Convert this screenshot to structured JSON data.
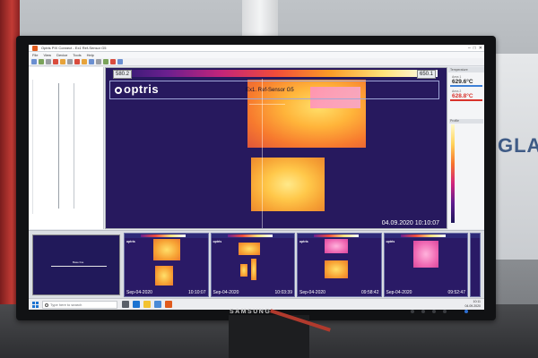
{
  "window": {
    "title": "Optris PIX Connect - Ex1 Ref-Sensor G5",
    "controls": [
      "–",
      "□",
      "✕"
    ]
  },
  "menu": [
    "File",
    "View",
    "Device",
    "Tools",
    "Help"
  ],
  "thermal_view": {
    "scale_min": "580.2",
    "scale_max": "650.1",
    "logo_text": "optris",
    "measure_label": "Ex1. Ref-Sensor G5",
    "timestamp": "04.09.2020  10:10:07"
  },
  "right_panel": {
    "header": "Temperature",
    "temp1": {
      "label": "Area 1",
      "value": "629.6°C",
      "color": "#3d7fd6"
    },
    "temp2": {
      "label": "Area 2",
      "value": "628.8°C",
      "color": "#d8322b"
    },
    "sub_header": "Profile"
  },
  "mini_view": {
    "label": "Base line"
  },
  "thumbnails": [
    {
      "logo": "optris",
      "date": "Sep-04-2020",
      "time": "10:10:07"
    },
    {
      "logo": "optris",
      "date": "Sep-04-2020",
      "time": "10:03:39"
    },
    {
      "logo": "optris",
      "date": "Sep-04-2020",
      "time": "09:58:42"
    },
    {
      "logo": "optris",
      "date": "Sep-04-2020",
      "time": "09:52:47"
    },
    {
      "logo": "optris",
      "date": "",
      "time": ""
    }
  ],
  "taskbar": {
    "search_placeholder": "Type here to search",
    "clock_time": "10:11",
    "clock_date": "04.09.2020"
  },
  "monitor_brand": "SAMSUNG",
  "background_text": "GLA",
  "colors": {
    "thermal_bg": "#27195e",
    "accent_blue": "#3d7fd6",
    "alarm_red": "#d8322b"
  }
}
